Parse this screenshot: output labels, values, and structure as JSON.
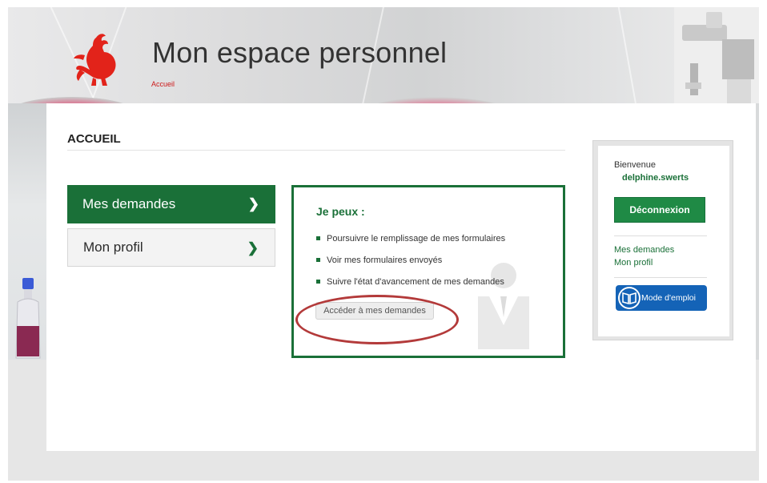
{
  "header": {
    "title": "Mon espace personnel",
    "breadcrumb": "Accueil"
  },
  "section": {
    "title": "ACCUEIL"
  },
  "nav": {
    "items": [
      {
        "label": "Mes demandes",
        "active": true,
        "icon": "chevron-right-icon"
      },
      {
        "label": "Mon profil",
        "active": false,
        "icon": "chevron-right-icon"
      }
    ]
  },
  "panel": {
    "title": "Je peux :",
    "items": [
      "Poursuivre le remplissage de mes formulaires",
      "Voir mes formulaires envoyés",
      "Suivre l'état d'avancement de mes demandes"
    ],
    "button": "Accéder à mes demandes",
    "watermark_icon": "user-silhouette-icon"
  },
  "welcome": {
    "label": "Bienvenue",
    "username": "delphine.swerts",
    "logout": "Déconnexion",
    "links": [
      "Mes demandes",
      "Mon profil"
    ],
    "manual": "Mode d'emploi",
    "manual_icon": "book-icon"
  },
  "colors": {
    "brand_green": "#1a7038",
    "button_green": "#1f8a45",
    "manual_blue": "#1463b7",
    "logo_red": "#e2231a",
    "annotation_red": "#b33a3a"
  }
}
